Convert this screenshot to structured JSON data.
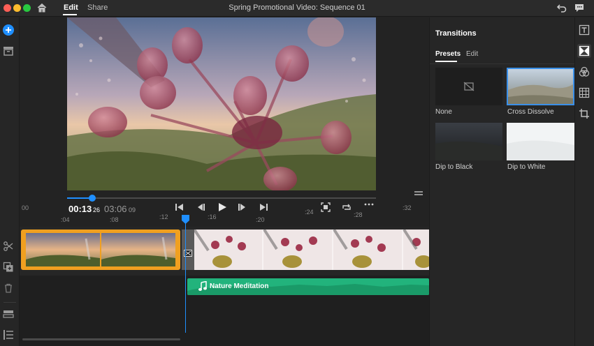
{
  "titlebar": {
    "tabs": [
      "Edit",
      "Share"
    ],
    "document_title": "Spring Promotional Video: Sequence 01",
    "colors": {
      "close": "#ff5f57",
      "minimize": "#febc2e",
      "zoom": "#28c840"
    }
  },
  "transport": {
    "current_time": "00:13",
    "current_frame": "26",
    "duration": "03:06",
    "duration_frame": "09"
  },
  "ruler": {
    "top_ticks": [
      "00",
      ":12",
      ":24",
      ":32"
    ],
    "bottom_ticks": [
      ":04",
      ":08",
      ":16",
      ":20",
      ":28"
    ]
  },
  "timeline": {
    "audio_clip_label": "Nature Meditation",
    "accent": "#f0a020",
    "audio_color": "#22b37c",
    "playhead_color": "#1f8fff"
  },
  "panel": {
    "title": "Transitions",
    "tabs": [
      "Presets",
      "Edit"
    ],
    "presets": [
      {
        "label": "None",
        "selected": false
      },
      {
        "label": "Cross Dissolve",
        "selected": true
      },
      {
        "label": "Dip to Black",
        "selected": false
      },
      {
        "label": "Dip to White",
        "selected": false
      }
    ]
  },
  "icons": {
    "left_rail": [
      "add-icon",
      "library-icon",
      "scissors-icon",
      "duplicate-icon",
      "trash-icon",
      "audio-track-icon",
      "list-icon"
    ],
    "right_rail": [
      "titles-icon",
      "transitions-icon",
      "color-icon",
      "effects-icon",
      "crop-icon"
    ]
  }
}
